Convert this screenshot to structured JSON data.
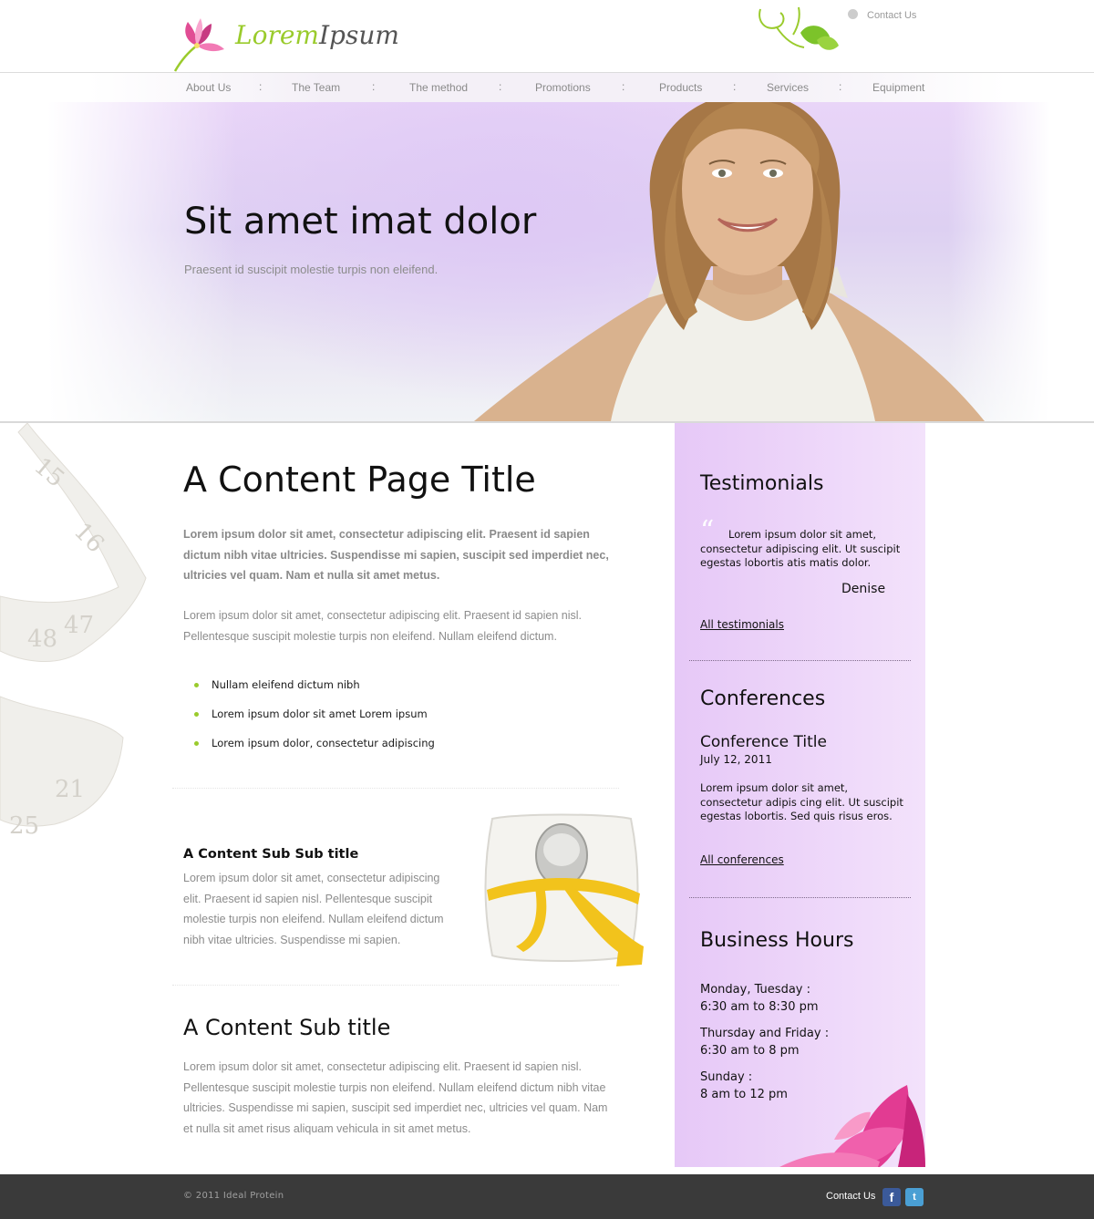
{
  "header": {
    "logo_word1": "Lorem",
    "logo_word2": "Ipsum",
    "contact_label": "Contact Us"
  },
  "nav": {
    "items": [
      {
        "label": "About Us"
      },
      {
        "label": "The Team"
      },
      {
        "label": "The method"
      },
      {
        "label": "Promotions"
      },
      {
        "label": "Products"
      },
      {
        "label": "Services"
      },
      {
        "label": "Equipment"
      }
    ],
    "separator": ":"
  },
  "hero": {
    "title": "Sit amet imat dolor",
    "subtitle": "Praesent id suscipit molestie turpis non eleifend."
  },
  "content": {
    "page_title": "A Content Page Title",
    "intro_bold": "Lorem ipsum dolor sit amet, consectetur adipiscing elit. Praesent id sapien dictum nibh vitae ultricies. Suspendisse mi sapien, suscipit sed imperdiet nec, ultricies vel quam. Nam et nulla sit amet metus.",
    "intro_text": "Lorem ipsum dolor sit amet, consectetur adipiscing elit. Praesent id sapien nisl. Pellentesque suscipit molestie turpis non eleifend. Nullam eleifend dictum.",
    "bullets": [
      "Nullam eleifend dictum nibh",
      "Lorem ipsum dolor sit amet Lorem ipsum",
      "Lorem ipsum dolor, consectetur adipiscing"
    ],
    "subsub_title": "A Content Sub Sub title",
    "subsub_text": "Lorem ipsum dolor sit amet, consectetur adipiscing elit. Praesent id sapien nisl. Pellentesque suscipit molestie turpis non eleifend. Nullam eleifend dictum nibh vitae ultricies. Suspendisse mi sapien.",
    "sub_title": "A Content Sub title",
    "sub_text": "Lorem ipsum dolor sit amet, consectetur adipiscing elit. Praesent id sapien nisl. Pellentesque suscipit molestie turpis non eleifend. Nullam eleifend dictum nibh vitae ultricies. Suspendisse mi sapien, suscipit sed imperdiet nec, ultricies vel quam. Nam et nulla sit amet risus aliquam vehicula in sit amet metus."
  },
  "sidebar": {
    "testimonials": {
      "title": "Testimonials",
      "quote": "Lorem ipsum dolor sit amet, consectetur adipiscing elit. Ut suscipit egestas lobortis atis matis dolor.",
      "author": "Denise",
      "link": "All testimonials"
    },
    "conferences": {
      "title": "Conferences",
      "item_title": "Conference Title",
      "item_date": "July 12, 2011",
      "item_text": "Lorem ipsum dolor sit amet, consectetur adipis cing elit. Ut suscipit egestas lobortis. Sed quis risus eros.",
      "link": "All conferences"
    },
    "hours": {
      "title": "Business Hours",
      "rows": [
        {
          "days": "Monday, Tuesday :",
          "time": "6:30 am to 8:30 pm"
        },
        {
          "days": "Thursday and Friday :",
          "time": "6:30 am to 8 pm"
        },
        {
          "days": "Sunday :",
          "time": "8 am to 12 pm"
        }
      ]
    }
  },
  "footer": {
    "copyright": "© 2011 Ideal Protein",
    "contact": "Contact Us",
    "facebook_glyph": "f",
    "twitter_glyph": "t"
  },
  "colors": {
    "accent_green": "#9acb2c",
    "sidebar_lavender": "#e6c8f7",
    "footer_dark": "#3a3a3a"
  },
  "icons": [
    "flower-logo-icon",
    "vine-decoration-icon",
    "contact-icon",
    "quote-icon",
    "facebook-icon",
    "twitter-icon"
  ]
}
